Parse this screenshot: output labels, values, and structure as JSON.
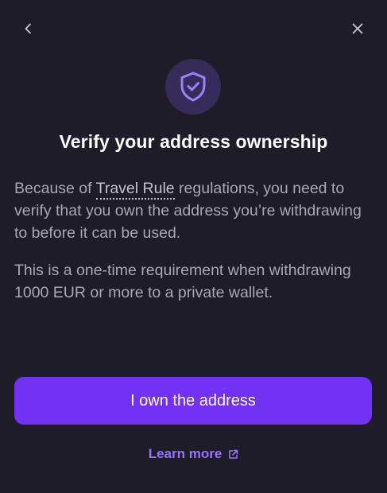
{
  "header": {
    "back_icon": "chevron-left-icon",
    "close_icon": "close-icon"
  },
  "badge": {
    "icon": "shield-check-icon",
    "bg_color": "#352c5a",
    "icon_color": "#9b80ff"
  },
  "title": "Verify your address ownership",
  "body": {
    "para1_before": "Because of ",
    "para1_term": "Travel Rule",
    "para1_after": " regulations, you need to verify that you own the address you’re withdrawing to before it can be used.",
    "para2": "This is a one-time requirement when withdrawing 1000 EUR or more to a private wallet."
  },
  "primary_button": {
    "label": "I own the address",
    "color": "#7132f5"
  },
  "learn_more": {
    "label": "Learn more",
    "icon": "external-link-icon",
    "color": "#9872fa"
  },
  "colors": {
    "background": "#1e1c28",
    "text_primary": "#ffffff",
    "text_secondary": "#a9a7b5"
  }
}
